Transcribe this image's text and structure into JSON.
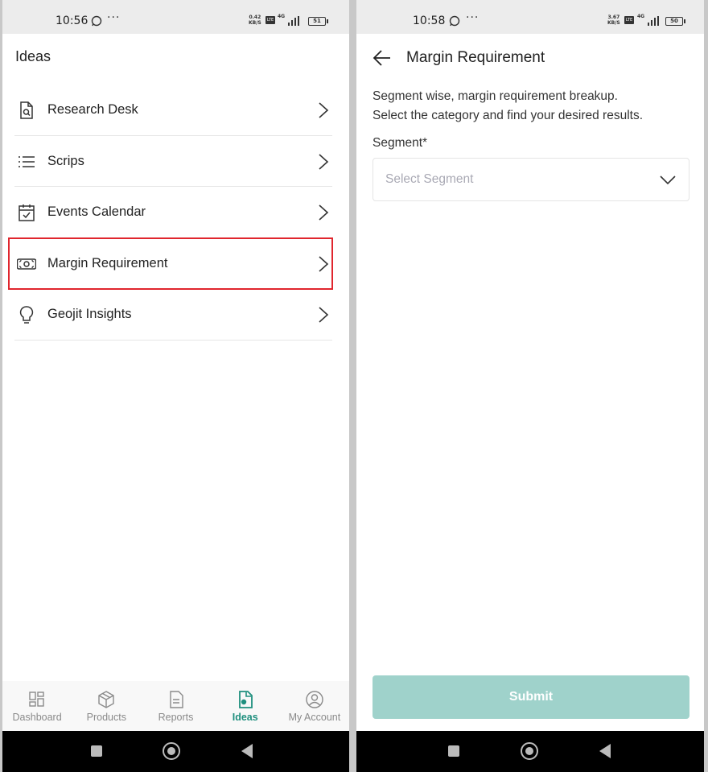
{
  "left": {
    "status": {
      "time": "10:56",
      "speed_top": "0.42",
      "speed_unit": "KB/S",
      "volte": "Vo LTE",
      "net_top": "4G",
      "net_bottom": "4G",
      "battery": "51"
    },
    "title": "Ideas",
    "menu": [
      {
        "label": "Research Desk",
        "icon": "document-search-icon"
      },
      {
        "label": "Scrips",
        "icon": "list-icon"
      },
      {
        "label": "Events Calendar",
        "icon": "calendar-check-icon"
      },
      {
        "label": "Margin Requirement",
        "icon": "money-note-icon",
        "highlighted": true
      },
      {
        "label": "Geojit Insights",
        "icon": "lightbulb-icon"
      }
    ],
    "nav": [
      {
        "label": "Dashboard",
        "icon": "dashboard-icon"
      },
      {
        "label": "Products",
        "icon": "box-icon"
      },
      {
        "label": "Reports",
        "icon": "report-icon"
      },
      {
        "label": "Ideas",
        "icon": "ideas-icon",
        "active": true
      },
      {
        "label": "My Account",
        "icon": "account-icon"
      }
    ]
  },
  "right": {
    "status": {
      "time": "10:58",
      "speed_top": "3.67",
      "speed_unit": "KB/S",
      "volte": "Vo LTE",
      "net_top": "4G",
      "battery": "50"
    },
    "page_title": "Margin Requirement",
    "description_line1": "Segment wise, margin requirement breakup.",
    "description_line2": "Select the category and find your desired results.",
    "segment_label": "Segment*",
    "segment_placeholder": "Select Segment",
    "submit_label": "Submit"
  },
  "colors": {
    "accent": "#1f8f7e",
    "submit_disabled": "#9fd2cb",
    "highlight_border": "#e0262e"
  }
}
